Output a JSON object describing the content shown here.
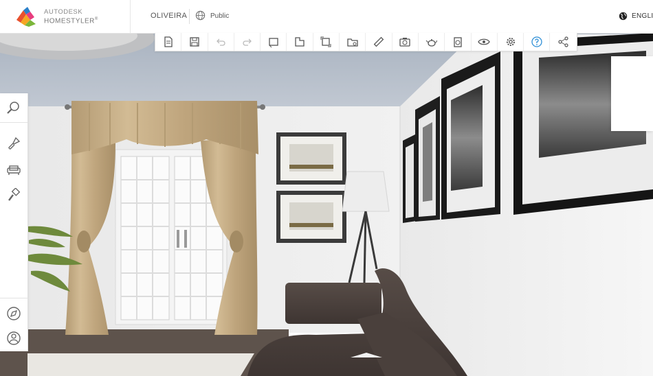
{
  "brand": {
    "line1": "AUTODESK",
    "line2": "HOMESTYLER",
    "mark": "®"
  },
  "project": {
    "name": "OLIVEIRA",
    "visibility": "Public"
  },
  "language": {
    "label": "ENGLIS"
  },
  "toolbar": {
    "items": [
      {
        "name": "new-file-icon"
      },
      {
        "name": "save-icon"
      },
      {
        "name": "undo-icon"
      },
      {
        "name": "redo-icon"
      },
      {
        "name": "floorplan-icon"
      },
      {
        "name": "room-shape-icon"
      },
      {
        "name": "3d-view-icon"
      },
      {
        "name": "open-folder-icon"
      },
      {
        "name": "measure-icon"
      },
      {
        "name": "camera-icon"
      },
      {
        "name": "teapot-render-icon"
      },
      {
        "name": "cost-estimate-icon"
      },
      {
        "name": "eye-icon"
      },
      {
        "name": "gear-icon"
      },
      {
        "name": "help-icon"
      },
      {
        "name": "share-icon"
      }
    ]
  },
  "sidebar": {
    "items": [
      {
        "name": "search-icon"
      },
      {
        "name": "paint-brush-icon"
      },
      {
        "name": "sofa-icon"
      },
      {
        "name": "paint-roller-icon"
      },
      {
        "name": "compass-icon"
      },
      {
        "name": "user-icon"
      }
    ]
  },
  "colors": {
    "accent": "#2f8fd6",
    "toolbar_icon": "#555555"
  }
}
